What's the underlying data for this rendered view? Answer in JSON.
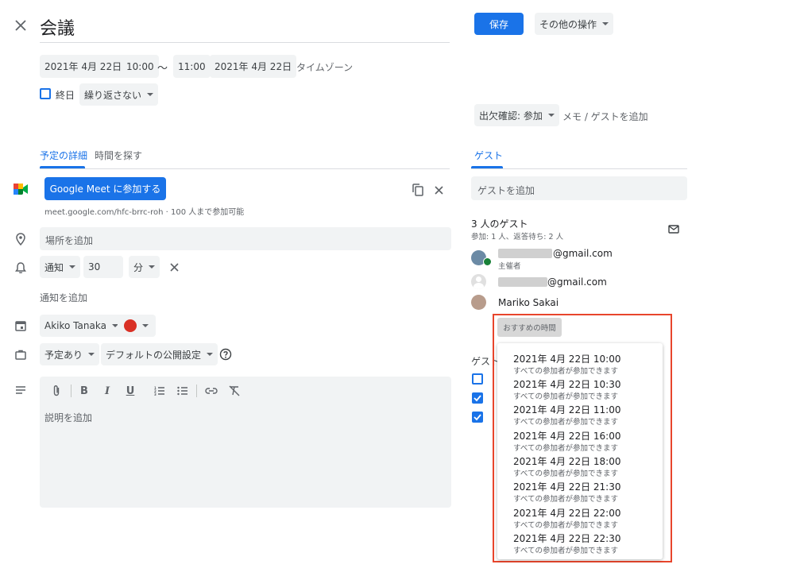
{
  "header": {
    "title": "会議",
    "save_label": "保存",
    "more_actions_label": "その他の操作"
  },
  "datetime": {
    "start_date": "2021年 4月 22日",
    "start_time": "10:00",
    "separator": "〜",
    "end_time": "11:00",
    "end_date": "2021年 4月 22日",
    "timezone_label": "タイムゾーン",
    "all_day_label": "終日",
    "repeat_label": "繰り返さない"
  },
  "rsvp": {
    "label": "出欠確認: 参加",
    "note_label": "メモ / ゲストを追加"
  },
  "tabs": {
    "details": "予定の詳細",
    "find_time": "時間を探す",
    "guests": "ゲスト"
  },
  "meet": {
    "button_label": "Google Meet に参加する",
    "link_text": "meet.google.com/hfc-brrc-roh · 100 人まで参加可能"
  },
  "location": {
    "placeholder": "場所を追加"
  },
  "notification": {
    "type": "通知",
    "value": "30",
    "unit": "分",
    "add_label": "通知を追加"
  },
  "calendar": {
    "owner": "Akiko Tanaka",
    "color": "#d93025"
  },
  "availability": {
    "status": "予定あり",
    "visibility": "デフォルトの公開設定"
  },
  "description": {
    "placeholder": "説明を追加"
  },
  "guests": {
    "add_placeholder": "ゲストを追加",
    "count_label": "3 人のゲスト",
    "summary": "参加: 1 人、返答待ち: 2 人",
    "list": [
      {
        "email": "@gmail.com",
        "role": "主催者"
      },
      {
        "email": "@gmail.com",
        "role": ""
      },
      {
        "name": "Mariko Sakai"
      }
    ],
    "suggested_button": "おすすめの時間",
    "permissions_label": "ゲスト"
  },
  "suggestions": [
    {
      "time": "2021年 4月 22日 10:00",
      "note": "すべての参加者が参加できます"
    },
    {
      "time": "2021年 4月 22日 10:30",
      "note": "すべての参加者が参加できます"
    },
    {
      "time": "2021年 4月 22日 11:00",
      "note": "すべての参加者が参加できます"
    },
    {
      "time": "2021年 4月 22日 16:00",
      "note": "すべての参加者が参加できます"
    },
    {
      "time": "2021年 4月 22日 18:00",
      "note": "すべての参加者が参加できます"
    },
    {
      "time": "2021年 4月 22日 21:30",
      "note": "すべての参加者が参加できます"
    },
    {
      "time": "2021年 4月 22日 22:00",
      "note": "すべての参加者が参加できます"
    },
    {
      "time": "2021年 4月 22日 22:30",
      "note": "すべての参加者が参加できます"
    }
  ],
  "colors": {
    "accent": "#1a73e8",
    "highlight_border": "#e8452c"
  },
  "icons": {
    "close": "close-icon",
    "meet": "google-meet-icon",
    "copy": "copy-icon",
    "location": "location-pin-icon",
    "bell": "bell-icon",
    "calendar": "calendar-icon",
    "briefcase": "briefcase-icon",
    "notes": "notes-icon",
    "help": "help-icon",
    "mail": "mail-icon"
  }
}
